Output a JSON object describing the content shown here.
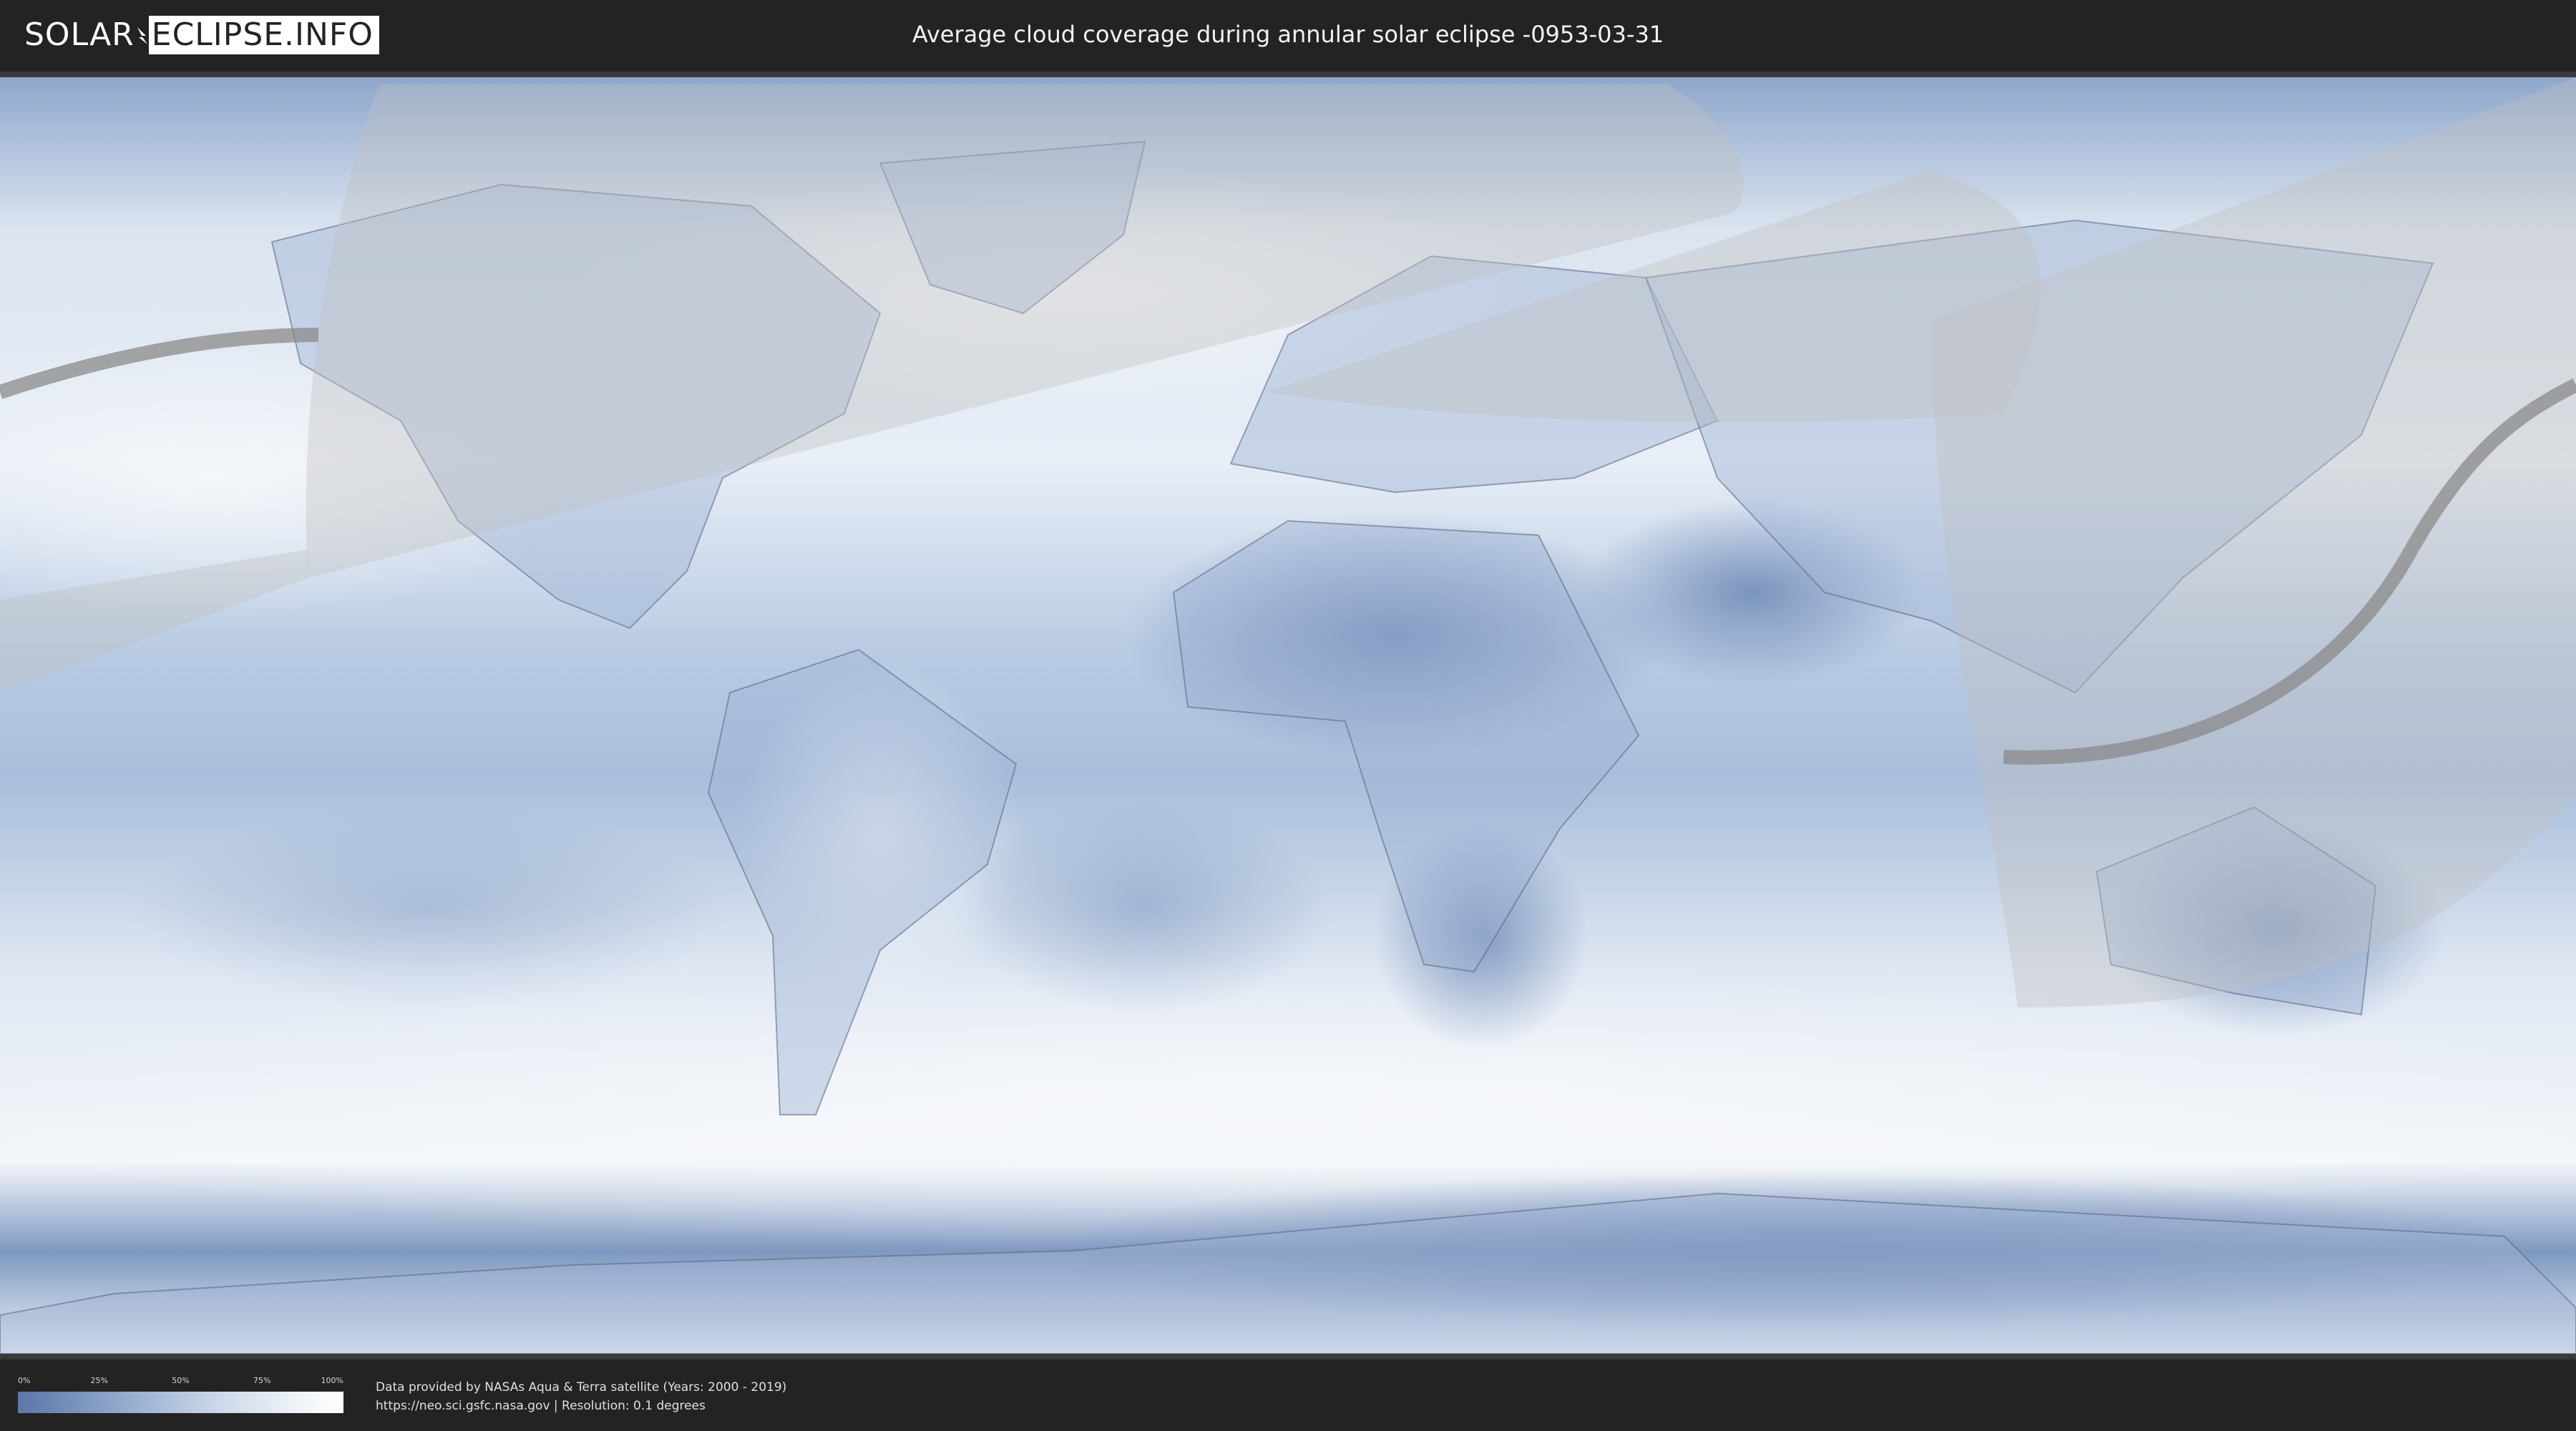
{
  "header": {
    "logo_left": "SOLAR",
    "logo_right": "ECLIPSE.INFO",
    "title": "Average cloud coverage during annular solar eclipse -0953-03-31"
  },
  "legend": {
    "ticks": [
      "0%",
      "25%",
      "50%",
      "75%",
      "100%"
    ],
    "tick_values": [
      0,
      25,
      50,
      75,
      100
    ],
    "colors": [
      "#5b76a8",
      "#8fa7cc",
      "#c9d6e8",
      "#eef2f8",
      "#ffffff"
    ]
  },
  "credits": {
    "line1": "Data provided by NASAs Aqua & Terra satellite (Years: 2000 - 2019)",
    "line2": "https://neo.sci.gsfc.nasa.gov | Resolution: 0.1 degrees"
  },
  "map_colors": {
    "cloud_low": "#6d88b6",
    "cloud_mid": "#a9bedb",
    "cloud_high": "#f3f6fa",
    "eclipse_overlay": "#bfbfbf",
    "path_line": "#8a8a8a"
  }
}
